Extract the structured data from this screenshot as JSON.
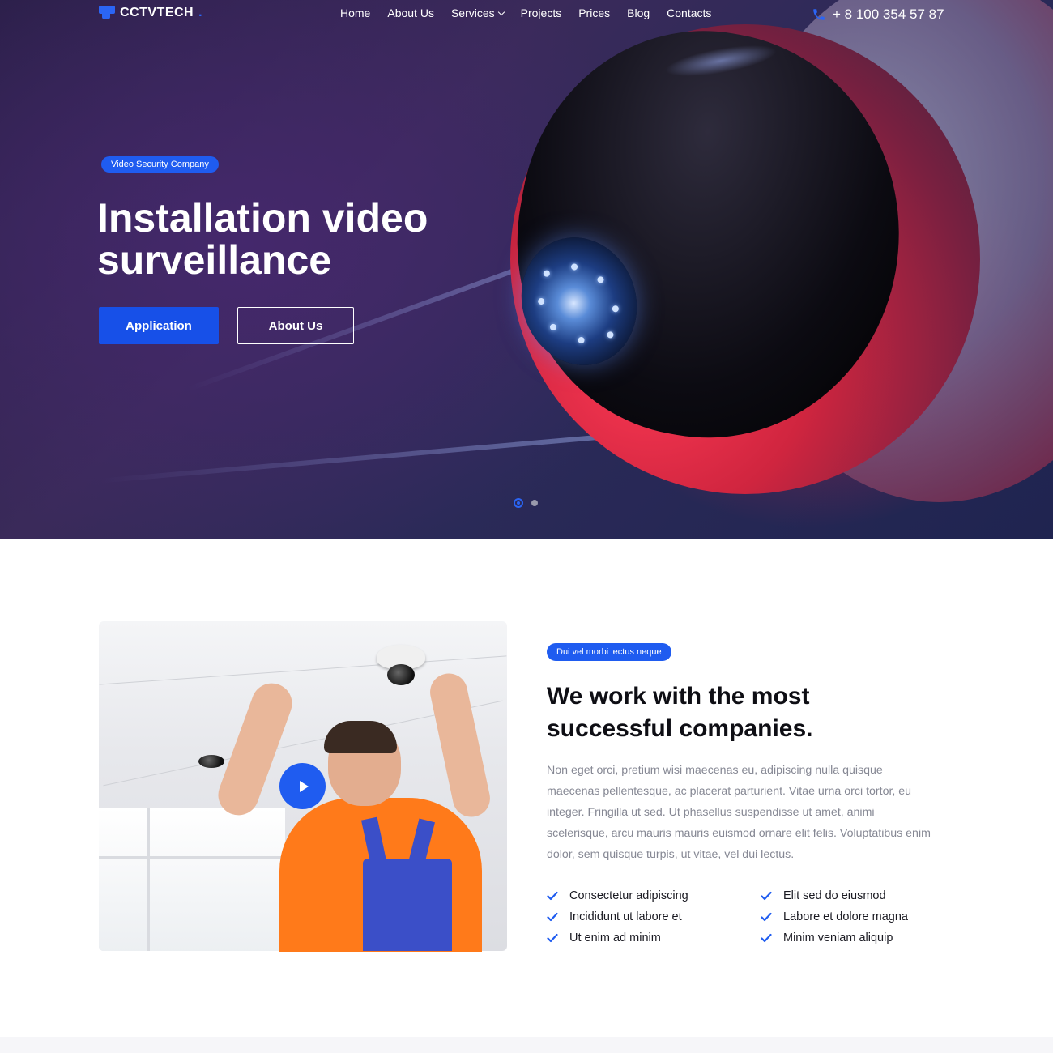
{
  "header": {
    "logo_text": "CCTVTECH",
    "logo_dot": ".",
    "nav": [
      {
        "label": "Home"
      },
      {
        "label": "About Us"
      },
      {
        "label": "Services"
      },
      {
        "label": "Projects"
      },
      {
        "label": "Prices"
      },
      {
        "label": "Blog"
      },
      {
        "label": "Contacts"
      }
    ],
    "phone": "+ 8 100 354 57 87"
  },
  "hero": {
    "tag": "Video Security Company",
    "title": "Installation video\nsurveillance",
    "primary_button": "Application",
    "secondary_button": "About Us",
    "slides": 2,
    "active_slide": 1
  },
  "about": {
    "tag": "Dui vel morbi lectus neque",
    "title": "We work with the most\nsuccessful companies.",
    "body": "Non eget orci, pretium wisi maecenas eu, adipiscing nulla quisque maecenas pellentesque, ac placerat parturient. Vitae urna orci tortor, eu integer. Fringilla ut sed. Ut phasellus suspendisse ut amet, animi scelerisque, arcu mauris mauris euismod ornare elit felis. Voluptatibus enim dolor, sem quisque turpis, ut vitae, vel dui lectus.",
    "checklist": [
      "Consectetur adipiscing",
      "Elit sed do eiusmod",
      "Incididunt ut labore et",
      "Labore et dolore magna",
      "Ut enim ad minim",
      "Minim veniam aliquip"
    ]
  },
  "colors": {
    "accent": "#1f5cf0",
    "hero_bg": "#2b2a58",
    "heading": "#0e0e14",
    "body_text": "#868894"
  },
  "icons": {
    "phone": "phone-icon",
    "check": "check-icon",
    "play": "play-icon",
    "logo": "camera-logo-icon"
  }
}
